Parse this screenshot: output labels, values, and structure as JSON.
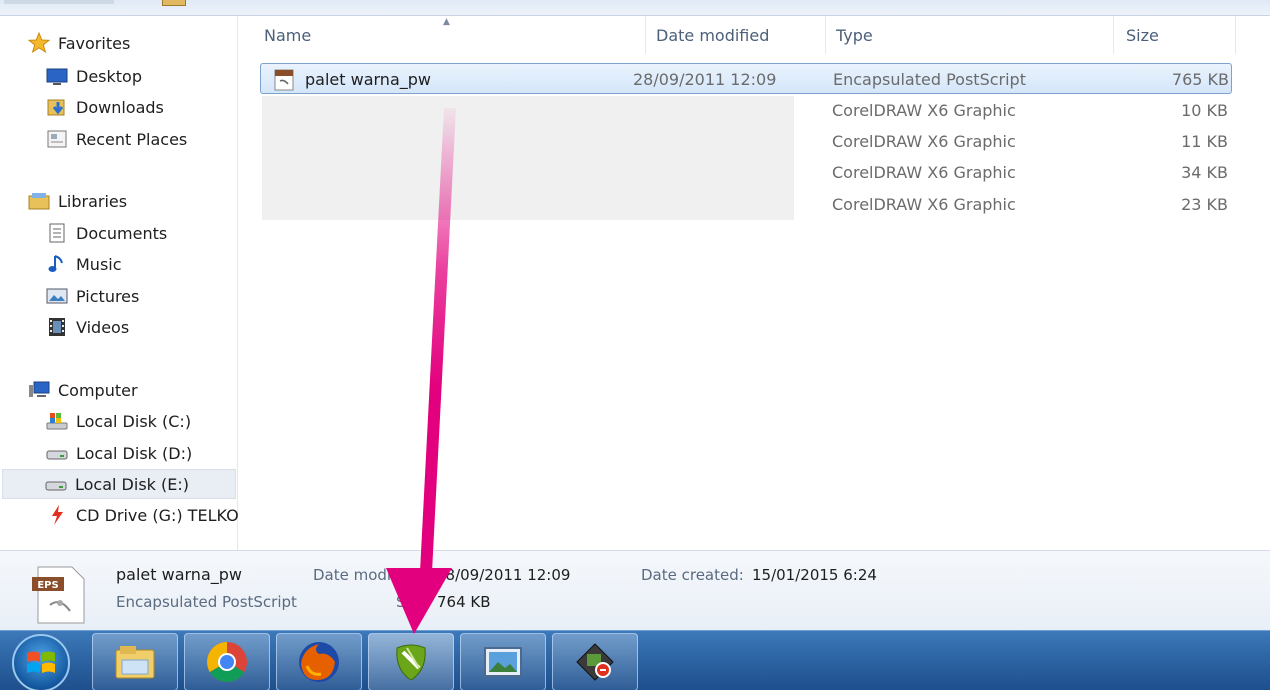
{
  "nav": {
    "favorites": "Favorites",
    "desktop": "Desktop",
    "downloads": "Downloads",
    "recent_places": "Recent Places",
    "libraries": "Libraries",
    "documents": "Documents",
    "music": "Music",
    "pictures": "Pictures",
    "videos": "Videos",
    "computer": "Computer",
    "disk_c": "Local Disk (C:)",
    "disk_d": "Local Disk (D:)",
    "disk_e": "Local Disk (E:)",
    "cd_drive": "CD Drive (G:) TELKO"
  },
  "columns": {
    "name": "Name",
    "date_modified": "Date modified",
    "type": "Type",
    "size": "Size"
  },
  "files": [
    {
      "name": "palet warna_pw",
      "date": "28/09/2011 12:09",
      "type": "Encapsulated PostScript",
      "size": "765 KB"
    },
    {
      "name": "",
      "date": "",
      "type": "CorelDRAW X6 Graphic",
      "size": "10 KB"
    },
    {
      "name": "",
      "date": "",
      "type": "CorelDRAW X6 Graphic",
      "size": "11 KB"
    },
    {
      "name": "",
      "date": "",
      "type": "CorelDRAW X6 Graphic",
      "size": "34 KB"
    },
    {
      "name": "",
      "date": "",
      "type": "CorelDRAW X6 Graphic",
      "size": "23 KB"
    }
  ],
  "details": {
    "icon_badge": "EPS",
    "file_name": "palet warna_pw",
    "file_type": "Encapsulated PostScript",
    "date_modified_label": "Date modi",
    "date_modified_value": "28/09/2011 12:09",
    "size_label": "Si",
    "size_value": "764 KB",
    "date_created_label": "Date created:",
    "date_created_value": "15/01/2015 6:24"
  },
  "taskbar": {
    "items": [
      "windows-explorer",
      "google-chrome",
      "firefox",
      "coreldraw",
      "picture-viewer",
      "corel-utility"
    ]
  },
  "colors": {
    "annotation_arrow": "#e3007e",
    "selection_border": "#7da2ce",
    "taskbar": "#2c63a2"
  }
}
